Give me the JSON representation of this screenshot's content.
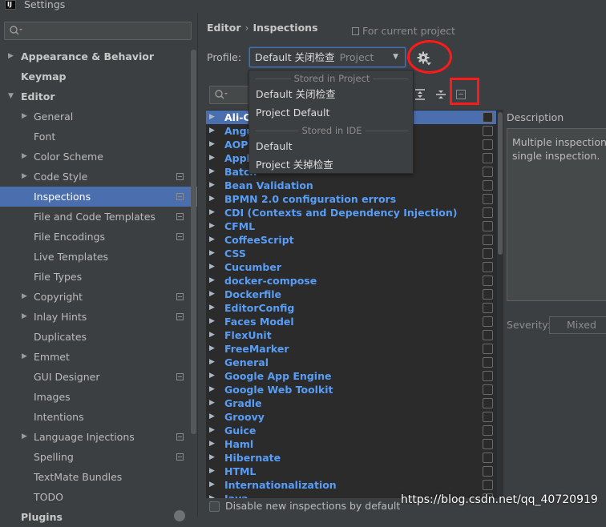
{
  "window": {
    "title": "Settings"
  },
  "search": {
    "placeholder": ""
  },
  "nav": [
    {
      "label": "Appearance & Behavior",
      "level": 0,
      "arrow": true,
      "bold": true,
      "cfg": false
    },
    {
      "label": "Keymap",
      "level": 0,
      "arrow": false,
      "bold": true,
      "cfg": false
    },
    {
      "label": "Editor",
      "level": 0,
      "arrow": true,
      "expanded": true,
      "bold": true,
      "cfg": false
    },
    {
      "label": "General",
      "level": 1,
      "arrow": true,
      "cfg": false
    },
    {
      "label": "Font",
      "level": 1,
      "arrow": false,
      "cfg": false
    },
    {
      "label": "Color Scheme",
      "level": 1,
      "arrow": true,
      "cfg": false
    },
    {
      "label": "Code Style",
      "level": 1,
      "arrow": true,
      "cfg": true
    },
    {
      "label": "Inspections",
      "level": 1,
      "arrow": false,
      "cfg": true,
      "selected": true
    },
    {
      "label": "File and Code Templates",
      "level": 1,
      "arrow": false,
      "cfg": true
    },
    {
      "label": "File Encodings",
      "level": 1,
      "arrow": false,
      "cfg": true
    },
    {
      "label": "Live Templates",
      "level": 1,
      "arrow": false,
      "cfg": false
    },
    {
      "label": "File Types",
      "level": 1,
      "arrow": false,
      "cfg": false
    },
    {
      "label": "Copyright",
      "level": 1,
      "arrow": true,
      "cfg": true
    },
    {
      "label": "Inlay Hints",
      "level": 1,
      "arrow": true,
      "cfg": true
    },
    {
      "label": "Duplicates",
      "level": 1,
      "arrow": false,
      "cfg": false
    },
    {
      "label": "Emmet",
      "level": 1,
      "arrow": true,
      "cfg": false
    },
    {
      "label": "GUI Designer",
      "level": 1,
      "arrow": false,
      "cfg": true
    },
    {
      "label": "Images",
      "level": 1,
      "arrow": false,
      "cfg": false
    },
    {
      "label": "Intentions",
      "level": 1,
      "arrow": false,
      "cfg": false
    },
    {
      "label": "Language Injections",
      "level": 1,
      "arrow": true,
      "cfg": true
    },
    {
      "label": "Spelling",
      "level": 1,
      "arrow": false,
      "cfg": true
    },
    {
      "label": "TextMate Bundles",
      "level": 1,
      "arrow": false,
      "cfg": false
    },
    {
      "label": "TODO",
      "level": 1,
      "arrow": false,
      "cfg": false
    },
    {
      "label": "Plugins",
      "level": 0,
      "arrow": false,
      "bold": true,
      "cfg": false
    }
  ],
  "breadcrumb": {
    "parent": "Editor",
    "separator": "›",
    "current": "Inspections"
  },
  "for_current_project": "For current project",
  "profile": {
    "label": "Profile:",
    "value": "Default 关闭检查",
    "scope": "Project",
    "caret": "▼"
  },
  "profile_dropdown": {
    "group_project": "Stored in Project",
    "items_project": [
      "Default 关闭检查",
      "Project Default"
    ],
    "group_ide": "Stored in IDE",
    "items_ide": [
      "Default",
      "Project 关掉检查"
    ]
  },
  "inspections": [
    {
      "name": "Ali-C",
      "selected": true
    },
    {
      "name": "Angu"
    },
    {
      "name": "AOP"
    },
    {
      "name": "Appl"
    },
    {
      "name": "Batch"
    },
    {
      "name": "Bean Validation"
    },
    {
      "name": "BPMN 2.0 configuration errors"
    },
    {
      "name": "CDI (Contexts and Dependency Injection)"
    },
    {
      "name": "CFML"
    },
    {
      "name": "CoffeeScript"
    },
    {
      "name": "CSS"
    },
    {
      "name": "Cucumber"
    },
    {
      "name": "docker-compose"
    },
    {
      "name": "Dockerfile"
    },
    {
      "name": "EditorConfig"
    },
    {
      "name": "Faces Model"
    },
    {
      "name": "FlexUnit"
    },
    {
      "name": "FreeMarker"
    },
    {
      "name": "General"
    },
    {
      "name": "Google App Engine"
    },
    {
      "name": "Google Web Toolkit"
    },
    {
      "name": "Gradle"
    },
    {
      "name": "Groovy"
    },
    {
      "name": "Guice"
    },
    {
      "name": "Haml"
    },
    {
      "name": "Hibernate"
    },
    {
      "name": "HTML"
    },
    {
      "name": "Internationalization"
    },
    {
      "name": "Java"
    }
  ],
  "description": {
    "label": "Description",
    "lines": [
      "Multiple inspections",
      "single inspection."
    ]
  },
  "severity": {
    "label": "Severity:",
    "value": "Mixed",
    "caret": "▼"
  },
  "disable_new": "Disable new inspections by default",
  "watermark": "https://blog.csdn.net/qq_40720919",
  "colors": {
    "selection": "#4b6eaf",
    "link": "#589df6",
    "annotation": "#ff1a1a"
  }
}
